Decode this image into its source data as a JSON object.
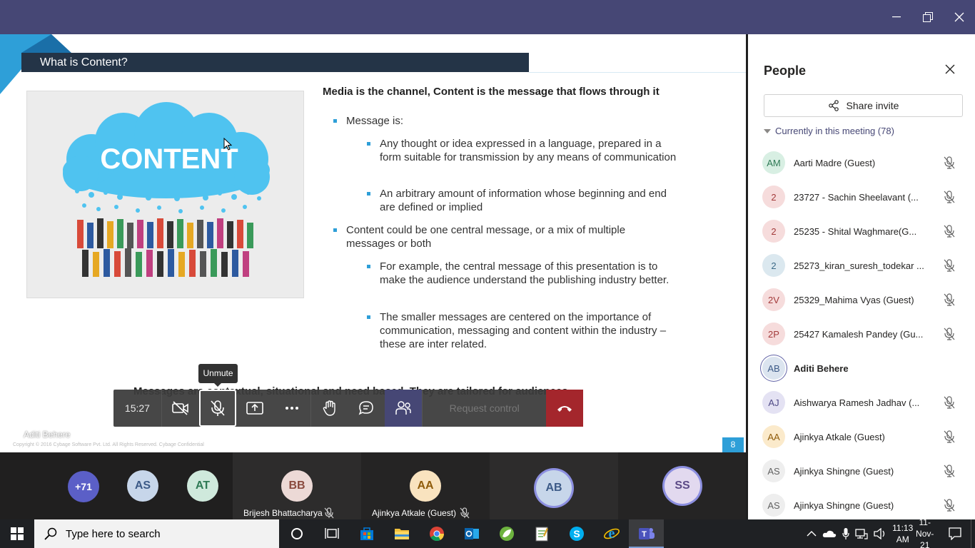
{
  "slide": {
    "title": "What is Content?",
    "image_text": "CONTENT",
    "heading": "Media is the channel, Content is the message that flows through it",
    "bullets": [
      {
        "text": "Message is:",
        "sub": [
          "Any thought or idea expressed in a language, prepared in a form suitable for transmission by any means of communication",
          "An arbitrary amount of information whose beginning and end are defined or implied"
        ]
      },
      {
        "text": "Content could be one central message, or a mix of multiple messages or both",
        "sub": [
          "For example, the central message of this presentation is to make the audience understand the publishing industry better.",
          "The smaller messages are centered on the importance of communication, messaging and content within the industry – these are inter related."
        ]
      }
    ],
    "footer_text": "Messages are contextual, situational and need based. They are tailored for audiences...",
    "presenter": "Aditi Behere",
    "copyright": "Copyright © 2016 Cybage Software Pvt. Ltd. All Rights Reserved. Cybage Confidential",
    "page_number": "8"
  },
  "controls": {
    "timer": "15:27",
    "tooltip": "Unmute",
    "request_control": "Request control"
  },
  "strip": {
    "overflow": "+71",
    "small_avatars": [
      {
        "initials": "AS",
        "color": "#c7d6ea",
        "text": "#3c5a87"
      },
      {
        "initials": "AT",
        "color": "#cfe9dc",
        "text": "#2f7a55"
      }
    ],
    "tiles": [
      {
        "initials": "BB",
        "name": "Brijesh Bhattacharya",
        "color": "#ecd9d6",
        "text": "#8a4a3e"
      },
      {
        "initials": "AA",
        "name": "Ajinkya Atkale (Guest)",
        "color": "#f9e3bf",
        "text": "#8f5b0a"
      },
      {
        "initials": "AB",
        "name": "",
        "color": "#c7d6ea",
        "text": "#3c5a87"
      },
      {
        "initials": "SS",
        "name": "",
        "color": "#e2d9ef",
        "text": "#5b4a86"
      }
    ]
  },
  "panel": {
    "title": "People",
    "share_invite": "Share invite",
    "section": "Currently in this meeting (78)",
    "people": [
      {
        "initials": "AM",
        "name": "Aarti Madre (Guest)",
        "color": "#d8efe3",
        "text": "#2f7a55",
        "bold": false,
        "muted": true
      },
      {
        "initials": "2",
        "name": "23727 - Sachin Sheelavant (...",
        "color": "#f6dcdc",
        "text": "#a33b3b",
        "bold": false,
        "muted": true
      },
      {
        "initials": "2",
        "name": "25235 - Shital Waghmare(G...",
        "color": "#f6dcdc",
        "text": "#a33b3b",
        "bold": false,
        "muted": true
      },
      {
        "initials": "2",
        "name": "25273_kiran_suresh_todekar ...",
        "color": "#dbe8ef",
        "text": "#3c6a87",
        "bold": false,
        "muted": true
      },
      {
        "initials": "2V",
        "name": "25329_Mahima Vyas (Guest)",
        "color": "#f6dcdc",
        "text": "#a33b3b",
        "bold": false,
        "muted": true
      },
      {
        "initials": "2P",
        "name": "25427 Kamalesh Pandey (Gu...",
        "color": "#f6dcdc",
        "text": "#a33b3b",
        "bold": false,
        "muted": true
      },
      {
        "initials": "AB",
        "name": "Aditi Behere",
        "color": "#dbe4ef",
        "text": "#3c5a87",
        "bold": true,
        "muted": false
      },
      {
        "initials": "AJ",
        "name": "Aishwarya Ramesh Jadhav (...",
        "color": "#e4e2f3",
        "text": "#4f4a86",
        "bold": false,
        "muted": true
      },
      {
        "initials": "AA",
        "name": "Ajinkya Atkale (Guest)",
        "color": "#fbeacb",
        "text": "#8f5b0a",
        "bold": false,
        "muted": true
      },
      {
        "initials": "AS",
        "name": "Ajinkya Shingne (Guest)",
        "color": "#eeeeee",
        "text": "#616161",
        "bold": false,
        "muted": true
      },
      {
        "initials": "AS",
        "name": "Ajinkya Shingne (Guest)",
        "color": "#eeeeee",
        "text": "#616161",
        "bold": false,
        "muted": true
      }
    ]
  },
  "taskbar": {
    "search_placeholder": "Type here to search",
    "time": "11:13 AM",
    "date": "11-Nov-21"
  }
}
